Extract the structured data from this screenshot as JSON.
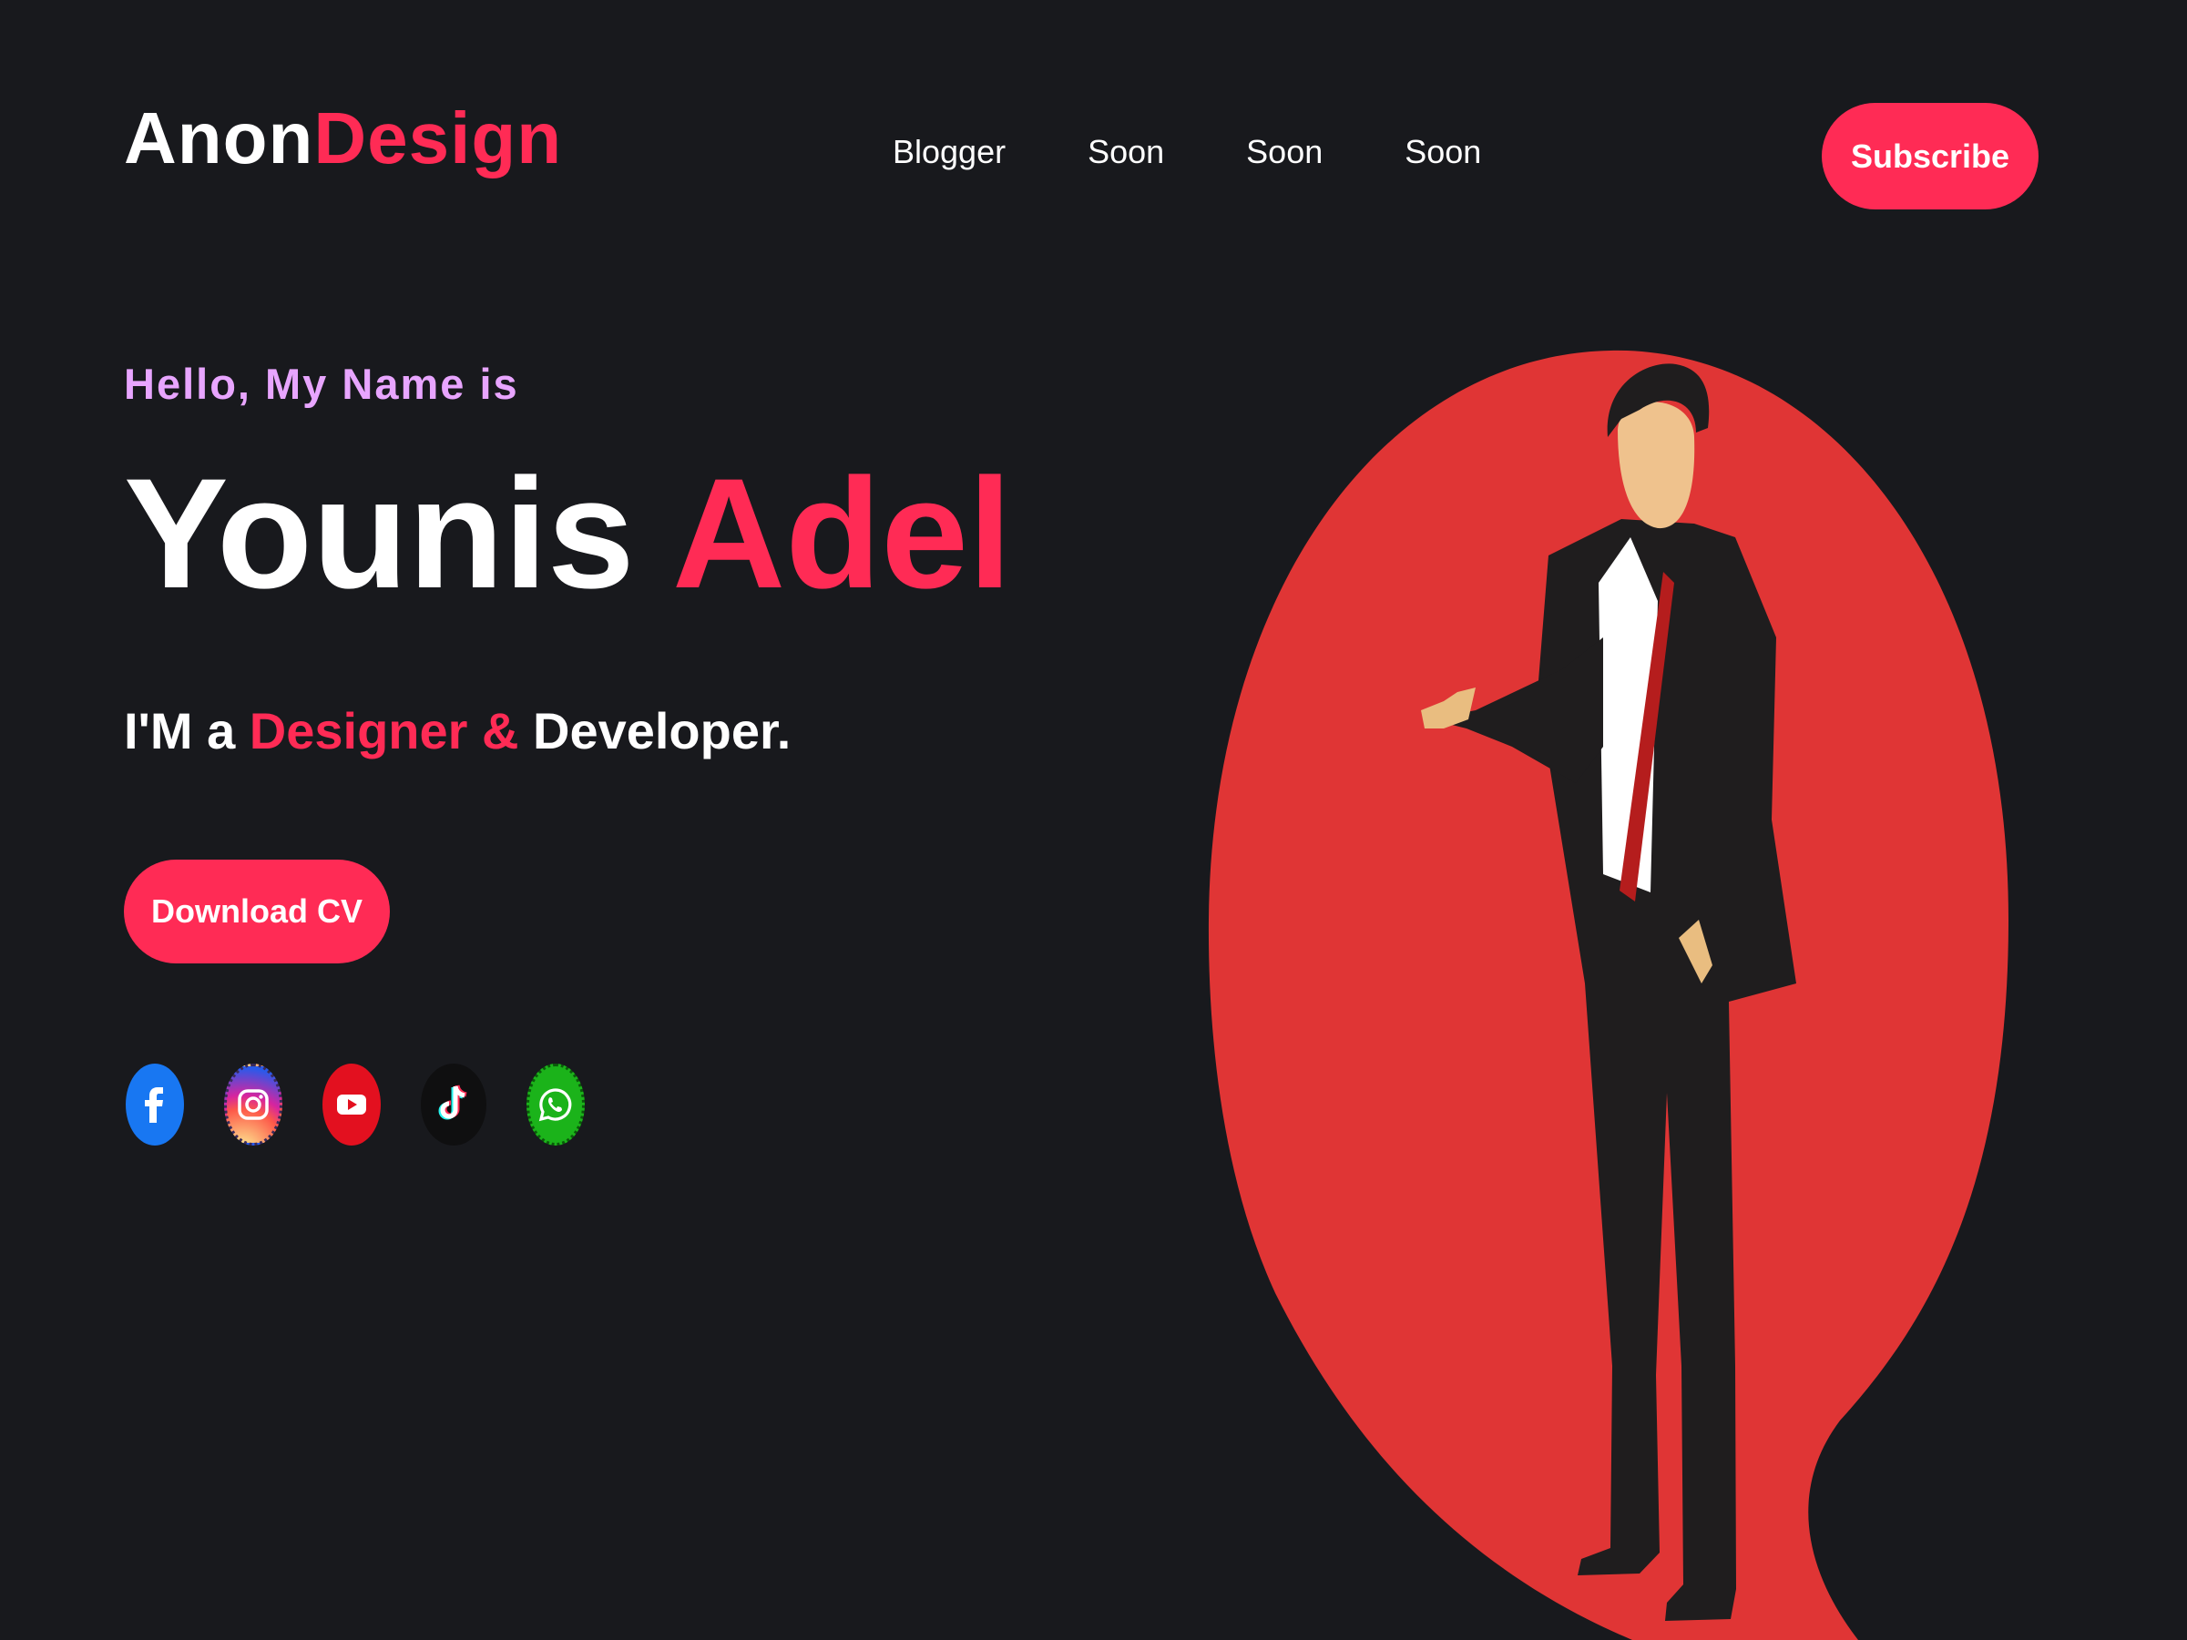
{
  "header": {
    "logo_part1": "Anon",
    "logo_part2": "Design",
    "nav": [
      {
        "label": "Blogger"
      },
      {
        "label": "Soon"
      },
      {
        "label": "Soon"
      },
      {
        "label": "Soon"
      }
    ],
    "subscribe_label": "Subscribe"
  },
  "hero": {
    "greeting": "Hello, My Name is",
    "first_name": "Younis",
    "last_name": "Adel",
    "role_prefix": "I'M a",
    "role_highlight": "Designer &",
    "role_suffix": "Developer.",
    "cv_label": "Download CV"
  },
  "socials": [
    {
      "icon": "facebook-icon"
    },
    {
      "icon": "instagram-icon"
    },
    {
      "icon": "youtube-icon"
    },
    {
      "icon": "tiktok-icon"
    },
    {
      "icon": "whatsapp-icon"
    }
  ],
  "colors": {
    "background": "#18191d",
    "accent": "#ff2b55",
    "greeting": "#e8a5ff",
    "spotlight": "#e03535"
  }
}
